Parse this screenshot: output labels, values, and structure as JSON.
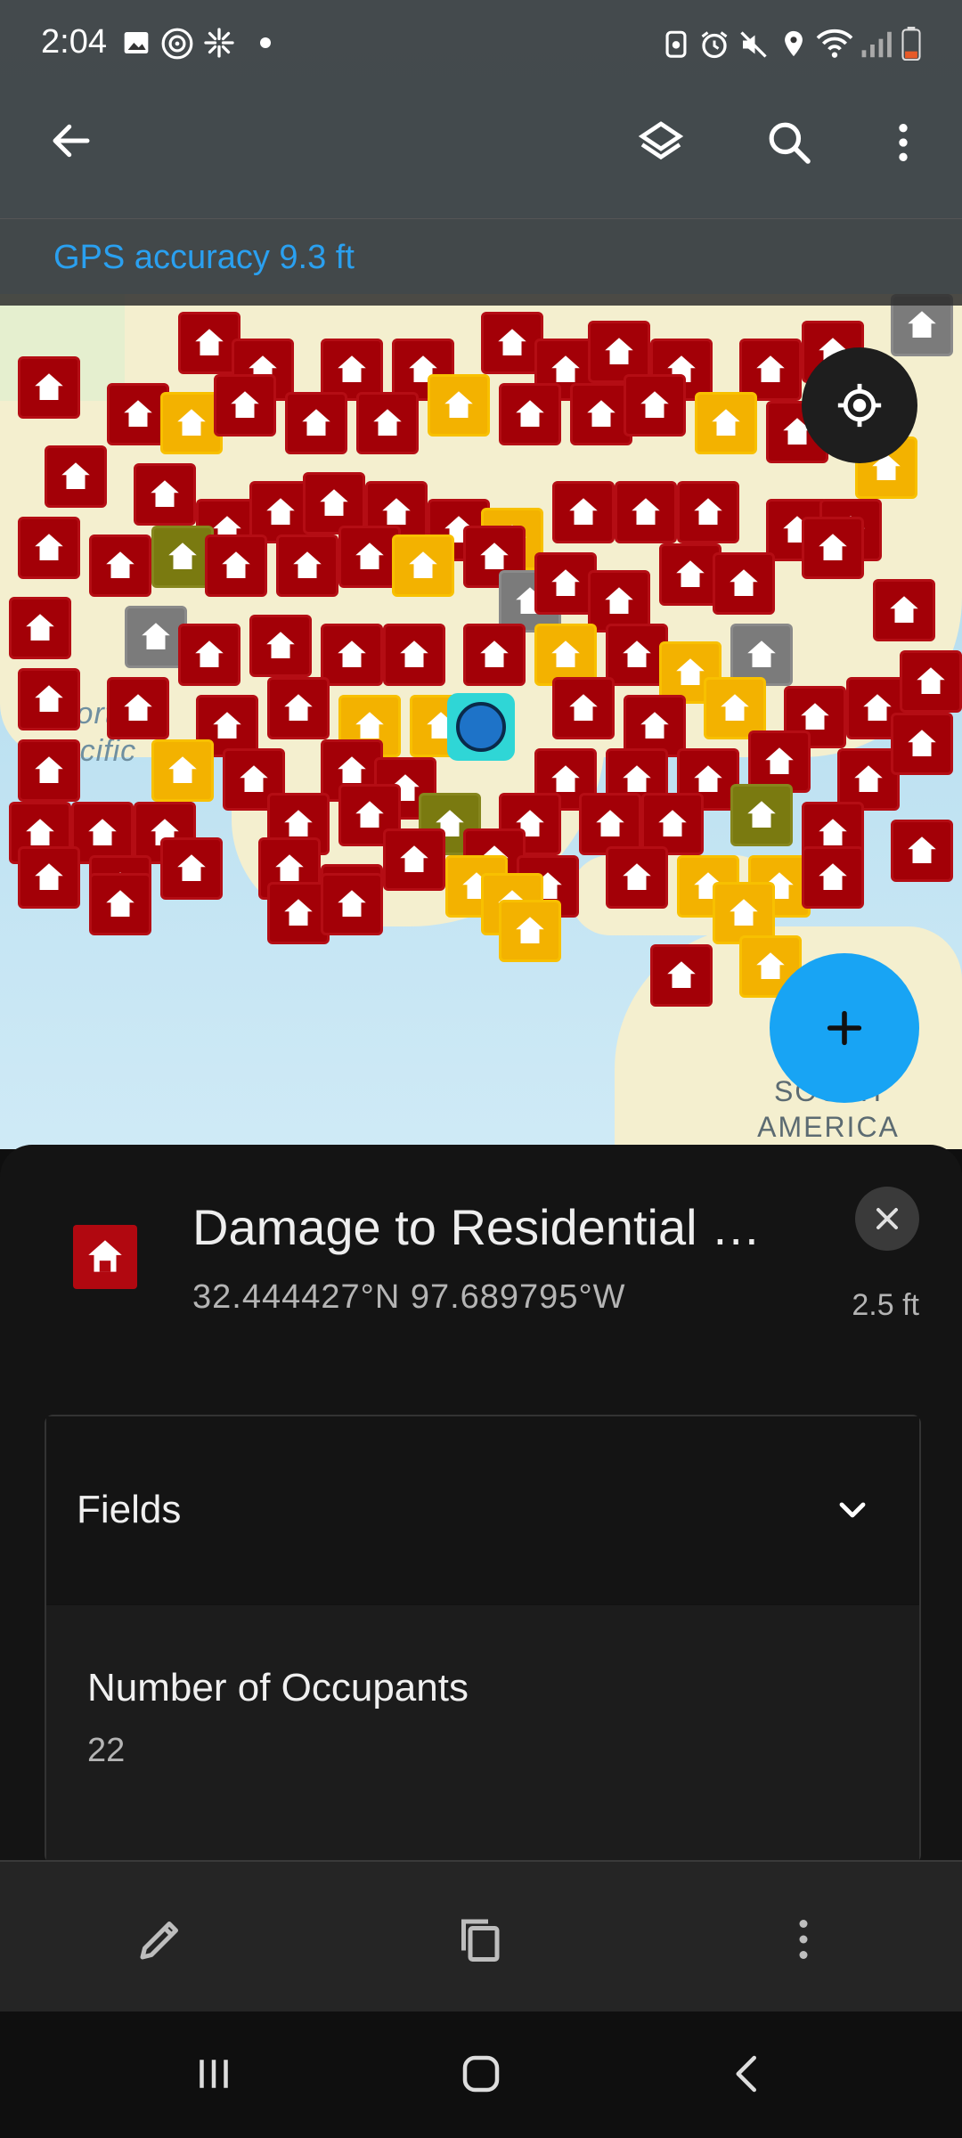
{
  "status_bar": {
    "time": "2:04",
    "left_icons": [
      "image-icon",
      "hotspot-icon",
      "pinwheel-icon",
      "dot-icon"
    ],
    "right_icons": [
      "recycle-icon",
      "alarm-icon",
      "mute-icon",
      "location-pin-icon",
      "wifi-icon",
      "signal-icon",
      "battery-icon"
    ]
  },
  "app_bar": {
    "back_icon": "arrow-left-icon",
    "actions": [
      "layers-icon",
      "search-icon",
      "more-vert-icon"
    ]
  },
  "gps": {
    "text": "GPS accuracy 9.3 ft"
  },
  "map": {
    "labels": {
      "north": "North",
      "pacific": "Pacific",
      "south_america": "SOUTH\nAMERICA"
    },
    "colors": {
      "red": "#a30007",
      "yellow": "#f3b200",
      "olive": "#7a7a10",
      "gray": "#7b7b7b",
      "user_dot": "#1e73c8"
    }
  },
  "fab": {
    "icon": "plus-icon"
  },
  "locate": {
    "icon": "gps-target-icon"
  },
  "feature": {
    "title": "Damage to Residential …",
    "coords": "32.444427°N  97.689795°W",
    "accuracy": "2.5 ft",
    "close_icon": "close-icon"
  },
  "fields": {
    "header": "Fields",
    "chevron_icon": "chevron-down-icon",
    "items": [
      {
        "label": "Number of Occupants",
        "value": "22"
      }
    ]
  },
  "actions": [
    "edit-icon",
    "copy-icon",
    "more-vert-icon"
  ],
  "nav": [
    "recents-icon",
    "home-icon",
    "back-icon"
  ]
}
